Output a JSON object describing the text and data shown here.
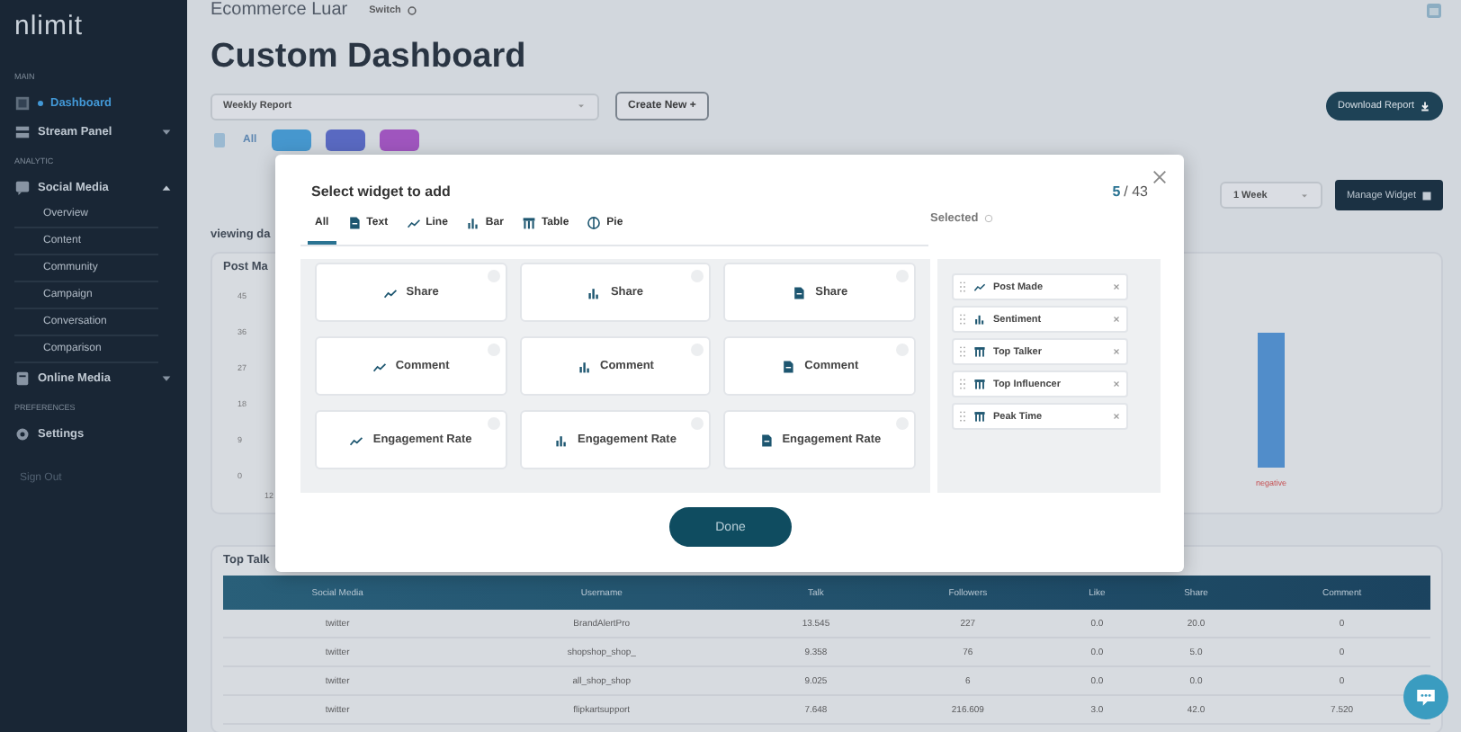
{
  "sidebar": {
    "logo": "nlimit",
    "sections": [
      {
        "header": "MAIN",
        "items": [
          {
            "label": "Dashboard",
            "selected": true
          },
          {
            "label": "Stream Panel",
            "selected": false,
            "expanded": false
          }
        ]
      },
      {
        "header": "ANALYTIC",
        "items": [
          {
            "label": "Social Media",
            "selected": false,
            "expanded": true,
            "children": [
              "Overview",
              "Content",
              "Community",
              "Campaign",
              "Conversation",
              "Comparison"
            ]
          },
          {
            "label": "Online Media",
            "selected": false,
            "expanded": false
          }
        ]
      },
      {
        "header": "PREFERENCES",
        "items": [
          {
            "label": "Settings",
            "selected": false
          }
        ]
      }
    ],
    "sign_out": "Sign Out"
  },
  "header": {
    "title": "Ecommerce Luar",
    "switch_button": "Switch"
  },
  "page_title": "Custom Dashboard",
  "report_select": {
    "value": "Weekly Report"
  },
  "create_button": {
    "label": "Create New",
    "icon_char": "+"
  },
  "download_button": "Download Report",
  "filter_bar": {
    "all_label": "All",
    "chips": [
      {
        "color": "#3f9ad6"
      },
      {
        "color": "#5566c8"
      },
      {
        "color": "#a44fc4"
      }
    ]
  },
  "period_select": {
    "value": "1 Week"
  },
  "manage_button": "Manage Widget",
  "viewing_text": "viewing da",
  "chart": {
    "title": "Post Ma",
    "y_labels": [
      "45",
      "36",
      "27",
      "18",
      "9",
      "0"
    ],
    "x_label": "12",
    "legend": "negative"
  },
  "table": {
    "title": "Top Talk",
    "columns": [
      "Social Media",
      "Username",
      "Talk",
      "Followers",
      "Like",
      "Share",
      "Comment"
    ],
    "rows": [
      [
        "twitter",
        "BrandAlertPro",
        "13.545",
        "227",
        "0.0",
        "20.0",
        "0"
      ],
      [
        "twitter",
        "shopshop_shop_",
        "9.358",
        "76",
        "0.0",
        "5.0",
        "0"
      ],
      [
        "twitter",
        "all_shop_shop",
        "9.025",
        "6",
        "0.0",
        "0.0",
        "0"
      ],
      [
        "twitter",
        "flipkartsupport",
        "7.648",
        "216.609",
        "3.0",
        "42.0",
        "7.520"
      ]
    ]
  },
  "modal": {
    "title": "Select widget to add",
    "count": "5",
    "total": "/ 43",
    "tabs": [
      {
        "label": "All",
        "selected": true
      },
      {
        "label": "Text",
        "selected": false
      },
      {
        "label": "Line",
        "selected": false
      },
      {
        "label": "Bar",
        "selected": false
      },
      {
        "label": "Table",
        "selected": false
      },
      {
        "label": "Pie",
        "selected": false
      }
    ],
    "selected_label": "Selected",
    "widgets": [
      {
        "kind": "line",
        "label": "Share",
        "selected": false
      },
      {
        "kind": "bar",
        "label": "Share",
        "selected": false
      },
      {
        "kind": "text",
        "label": "Share",
        "selected": false
      },
      {
        "kind": "line",
        "label": "Comment",
        "selected": false
      },
      {
        "kind": "bar",
        "label": "Comment",
        "selected": false
      },
      {
        "kind": "text",
        "label": "Comment",
        "selected": false
      },
      {
        "kind": "line",
        "label": "Engagement Rate",
        "selected": false
      },
      {
        "kind": "bar",
        "label": "Engagement Rate",
        "selected": false
      },
      {
        "kind": "text",
        "label": "Engagement Rate",
        "selected": false
      }
    ],
    "selected_widgets": [
      {
        "kind": "line",
        "label": "Post Made"
      },
      {
        "kind": "bar",
        "label": "Sentiment"
      },
      {
        "kind": "table",
        "label": "Top Talker"
      },
      {
        "kind": "table",
        "label": "Top Influencer"
      },
      {
        "kind": "table",
        "label": "Peak Time"
      }
    ],
    "done_button": "Done"
  }
}
